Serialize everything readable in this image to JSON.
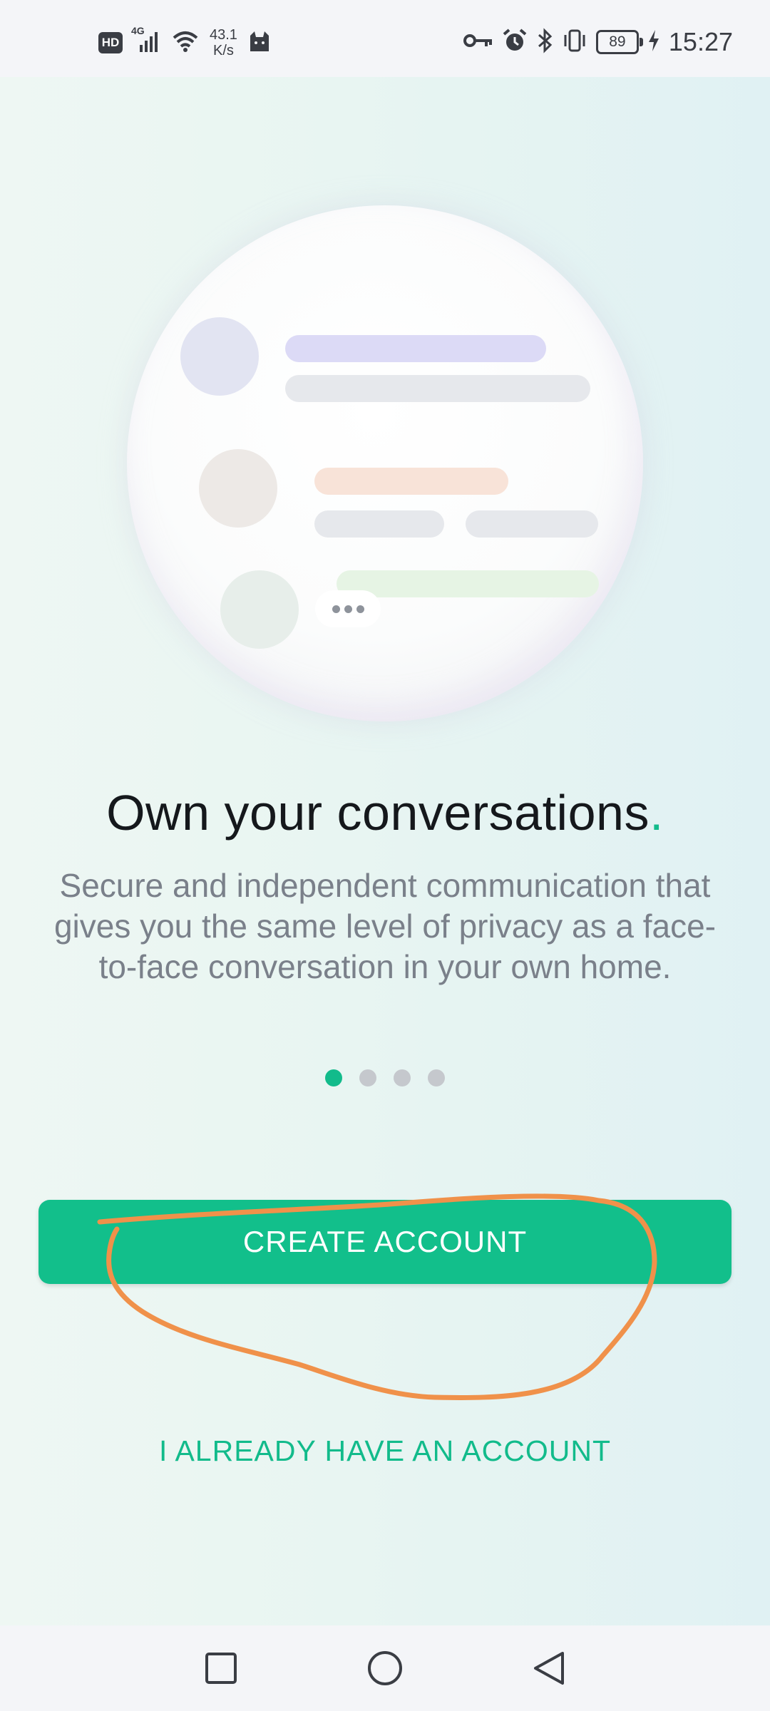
{
  "status_bar": {
    "hd_label": "HD",
    "network_type": "4G",
    "net_speed_value": "43.1",
    "net_speed_unit": "K/s",
    "battery_level": "89",
    "time": "15:27"
  },
  "onboarding": {
    "headline": "Own your conversations",
    "headline_dot": ".",
    "subtext": "Secure and independent communication that gives you the same level of privacy as a face-to-face conversation in your own home.",
    "page_count": 4,
    "active_page": 1
  },
  "actions": {
    "create_account_label": "CREATE ACCOUNT",
    "have_account_label": "I ALREADY HAVE AN ACCOUNT"
  },
  "nav_bar": {
    "icons": [
      "recents-square-icon",
      "home-circle-icon",
      "back-triangle-icon"
    ]
  },
  "colors": {
    "accent": "#12bf8b",
    "annotation": "#f0914a"
  }
}
